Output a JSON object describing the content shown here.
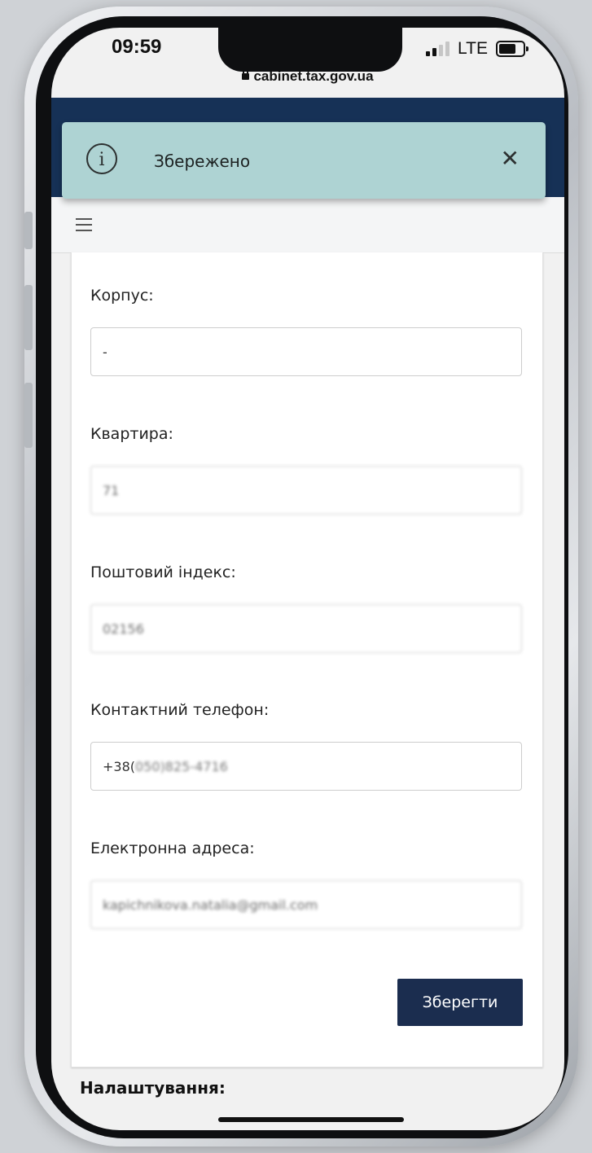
{
  "status_bar": {
    "time": "09:59",
    "network": "LTE",
    "icons": [
      "signal-icon",
      "battery-icon"
    ]
  },
  "browser": {
    "url": "cabinet.tax.gov.ua",
    "lock_icon": "lock-icon"
  },
  "toast": {
    "message": "Збережено",
    "icon": "info-icon",
    "close_icon": "close-icon",
    "background": "#aed3d3"
  },
  "header": {
    "color": "#163156",
    "menu_icon": "hamburger-icon"
  },
  "form": {
    "fields": [
      {
        "label": "Корпус:",
        "value": "-"
      },
      {
        "label": "Квартира:",
        "value": "71"
      },
      {
        "label": "Поштовий індекс:",
        "value": "02156"
      },
      {
        "label": "Контактний телефон:",
        "value_prefix": "+38(",
        "value_code": "050",
        "value_rest": ")825-4716"
      },
      {
        "label": "Електронна адреса:",
        "value": "kapichnikova.natalia@gmail.com"
      }
    ],
    "save_label": "Зберегти",
    "save_color": "#1b2d4f"
  },
  "settings": {
    "title": "Налаштування:"
  }
}
